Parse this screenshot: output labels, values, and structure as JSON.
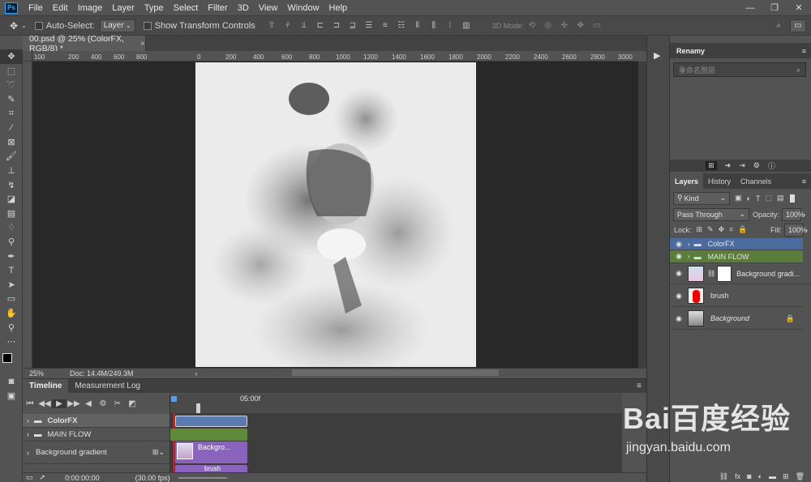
{
  "app": {
    "logo": "Ps"
  },
  "menu": [
    "File",
    "Edit",
    "Image",
    "Layer",
    "Type",
    "Select",
    "Filter",
    "3D",
    "View",
    "Window",
    "Help"
  ],
  "window_controls": [
    "minimize",
    "maximize",
    "close"
  ],
  "options_bar": {
    "auto_select_label": "Auto-Select:",
    "auto_select_value": "Layer",
    "show_transform_label": "Show Transform Controls",
    "mode_3d_label": "3D Mode:"
  },
  "document_tab": {
    "title": "00.psd @ 25% (ColorFX, RGB/8) *",
    "close": "×"
  },
  "ruler_top_labels": [
    "100",
    "200",
    "400",
    "600",
    "800",
    "0",
    "200",
    "400",
    "600",
    "800",
    "1000",
    "1200",
    "1400",
    "1600",
    "1800",
    "2000",
    "2200",
    "2400",
    "2600",
    "2800",
    "3000"
  ],
  "status_bar": {
    "zoom": "25%",
    "doc": "Doc: 14.4M/249.3M"
  },
  "timeline": {
    "tabs": [
      "Timeline",
      "Measurement Log"
    ],
    "time_label": "05:00f",
    "current_time": "0:00:00:00",
    "fps": "(30.00 fps)",
    "rows": [
      {
        "name": "ColorFX",
        "type": "group"
      },
      {
        "name": "MAIN FLOW",
        "type": "group"
      },
      {
        "name": "Background gradient",
        "type": "layer"
      }
    ],
    "clips": [
      {
        "label": "",
        "color": "#5a7ab0"
      },
      {
        "label": "",
        "color": "#5f8a3a"
      },
      {
        "label": "Backgro...",
        "color": "#8a63bd"
      },
      {
        "label": "brush",
        "color": "#8a63bd"
      }
    ]
  },
  "renamy": {
    "title": "Renamy",
    "search_placeholder": "重命名图层"
  },
  "layers_panel": {
    "tabs": [
      "Layers",
      "History",
      "Channels"
    ],
    "filter_kind": "Kind",
    "blend_mode": "Pass Through",
    "opacity_label": "Opacity:",
    "opacity_value": "100%",
    "lock_label": "Lock:",
    "fill_label": "Fill:",
    "fill_value": "100%",
    "layers": [
      {
        "name": "ColorFX",
        "type": "group",
        "highlight": "#4b6b9e"
      },
      {
        "name": "MAIN FLOW",
        "type": "group",
        "highlight": "#5a7d3b"
      },
      {
        "name": "Background gradi...",
        "type": "layer",
        "highlight": ""
      },
      {
        "name": "brush",
        "type": "layer",
        "highlight": ""
      },
      {
        "name": "Background",
        "type": "layer",
        "highlight": ""
      }
    ]
  },
  "watermark": {
    "text": "Bai百度经验",
    "url": "jingyan.baidu.com"
  }
}
